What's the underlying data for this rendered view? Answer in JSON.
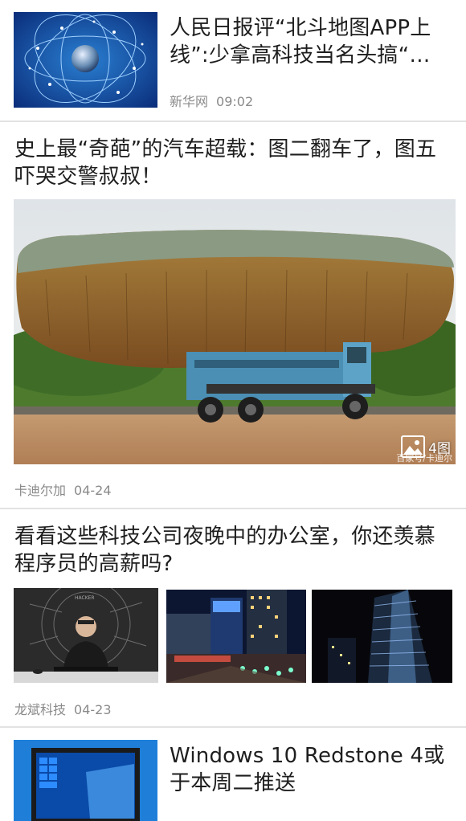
{
  "feed": {
    "items": [
      {
        "title": "人民日报评“北斗地图APP上线”:少拿高科技当名头搞“噱头”",
        "source": "新华网",
        "time": "09:02"
      },
      {
        "title": "史上最“奇葩”的汽车超载：图二翻车了，图五吓哭交警叔叔！",
        "source": "卡迪尔加",
        "time": "04-24",
        "image_count": "4图",
        "watermark": "百家号/卡迪尔"
      },
      {
        "title": "看看这些科技公司夜晚中的办公室，你还羡慕程序员的高薪吗?",
        "source": "龙斌科技",
        "time": "04-23",
        "screen_text": "HACKER"
      },
      {
        "title": "Windows 10 Redstone 4或于本周二推送",
        "source": "",
        "time": ""
      }
    ]
  },
  "colors": {
    "background": "#f4f4f4",
    "card": "#ffffff",
    "meta": "#8a8a8a",
    "separator": "#e2e2e2"
  }
}
